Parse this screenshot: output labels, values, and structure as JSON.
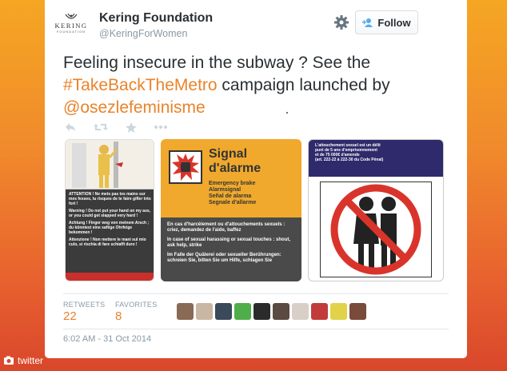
{
  "header": {
    "logo_word": "KERING",
    "logo_sub": "FOUNDATION",
    "name": "Kering Foundation",
    "handle": "@KeringForWomen",
    "follow_label": "Follow"
  },
  "tweet": {
    "text_part1": "Feeling insecure in the subway ? See the ",
    "hashtag": "#TakeBackTheMetro",
    "text_part2": " campaign launched by ",
    "mention": "@osezlefeminisme"
  },
  "media": {
    "left_panel": {
      "lines": [
        "ATTENTION ! Ne mets pas tes mains sur mes fesses, tu risques de te faire gifler très fort !",
        "Warning ! Do not put your hand on my ass, or you could get slapped very hard !",
        "Achtung ! Finger weg von meinem Arsch ; du könntest eine saftige Ohrfeige bekommen !",
        "Attenzione ! Non mettere le mani sul mio culo, si rischia di fare schiaffi duro !"
      ]
    },
    "middle_panel": {
      "title_line1": "Signal",
      "title_line2": "d'alarme",
      "list": [
        "Emergency brake",
        "Alarmsignal",
        "Señal de alarma",
        "Segnale d'allarme"
      ],
      "dark_lines": [
        "En cas d'harcèlement ou d'attouchements sexuels : criez, demandez de l'aide, baffez",
        "In case of sexual harassing or sexual touches : shout, ask help, strike",
        "Im Falle der Quälerei oder sexueller Berührungen: schreien Sie, bitten Sie um Hilfe, schlagen Sie"
      ]
    },
    "right_panel": {
      "lines": [
        "L'attouchement sexuel est un délit",
        "puni de 5 ans d'emprisonnement",
        "et de 75 000€ d'amende",
        "(art. 222-22 à 222-30 du Code Pénal)"
      ]
    }
  },
  "stats": {
    "retweets_label": "RETWEETS",
    "retweets_value": "22",
    "favorites_label": "FAVORITES",
    "favorites_value": "8"
  },
  "avatars": [
    {
      "color": "#8a6a55"
    },
    {
      "color": "#c9b7a3"
    },
    {
      "color": "#3b4a5a"
    },
    {
      "color": "#4fae4a"
    },
    {
      "color": "#2b2b2b"
    },
    {
      "color": "#5b4a3f"
    },
    {
      "color": "#d8d0c8"
    },
    {
      "color": "#c23b3b"
    },
    {
      "color": "#e2d24a"
    },
    {
      "color": "#7a4a3a"
    }
  ],
  "timestamp": "6:02 AM - 31 Oct 2014",
  "watermark": "twitter",
  "colors": {
    "link": "#e9832b",
    "text": "#292f33",
    "muted": "#8899a6"
  }
}
